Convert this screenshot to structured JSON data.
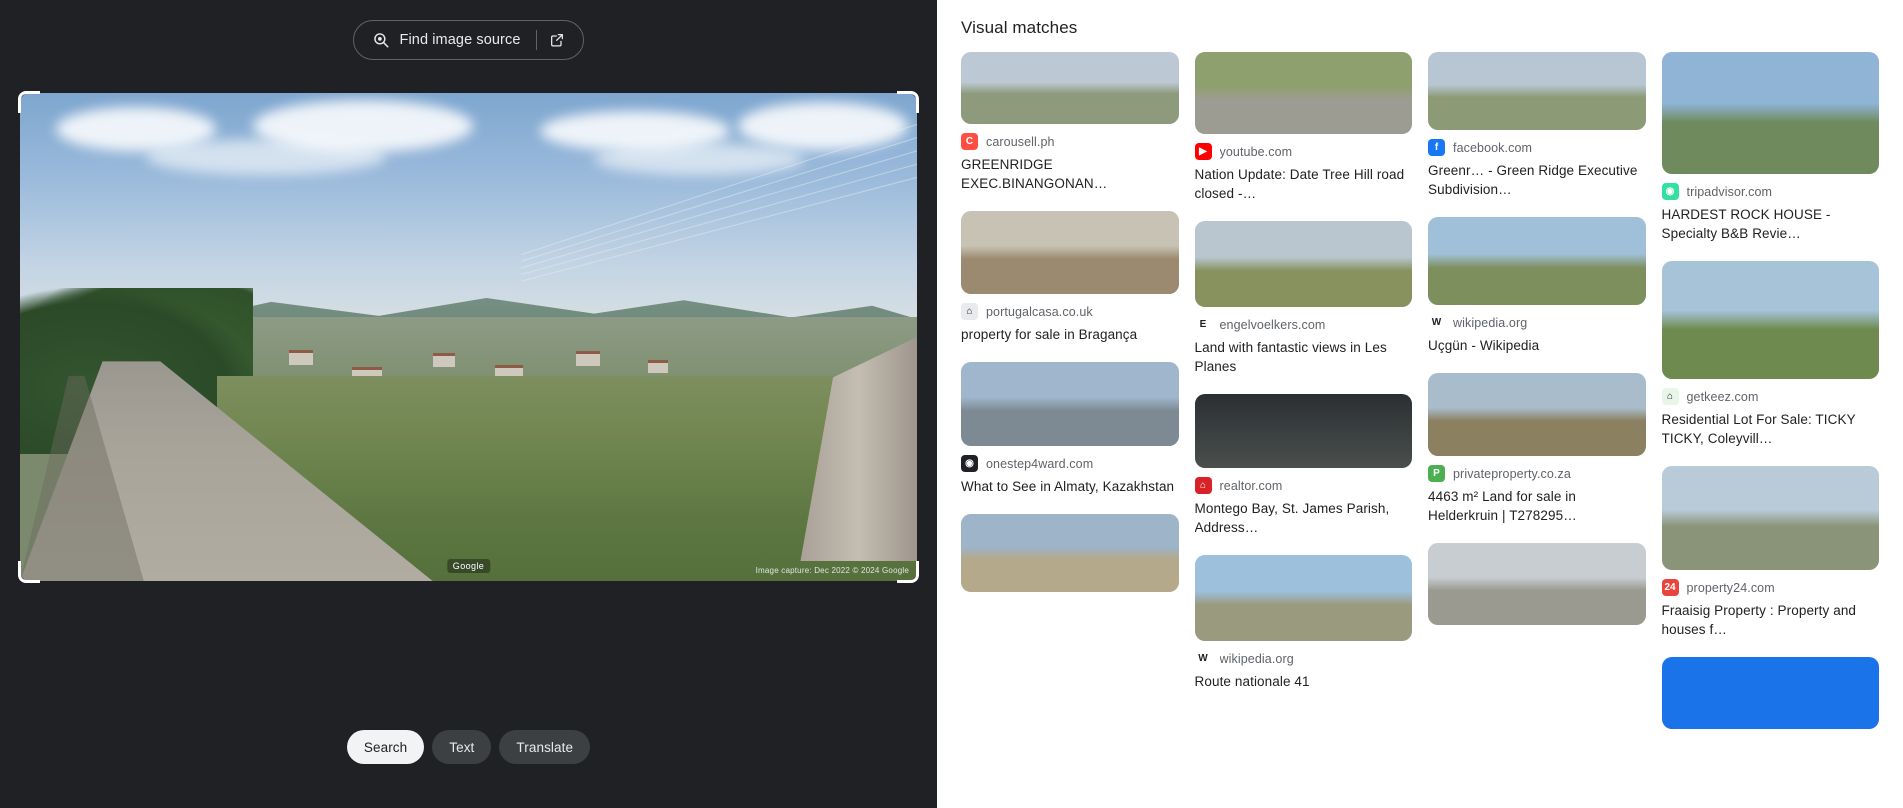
{
  "left": {
    "find_source_label": "Find image source",
    "find_source_icon": "lens-search-icon",
    "open_external_icon": "open-in-new-icon",
    "image_attribution": "Google",
    "image_attribution_right": "Image capture: Dec 2022  © 2024 Google",
    "tabs": [
      {
        "label": "Search",
        "active": true
      },
      {
        "label": "Text",
        "active": false
      },
      {
        "label": "Translate",
        "active": false
      }
    ]
  },
  "right": {
    "title": "Visual matches",
    "cards": [
      {
        "source": "carousell.ph",
        "title": "GREENRIDGE EXEC.BINANGONAN…",
        "thumb_h": 72,
        "favicon_bg": "#ff4f42",
        "favicon_glyph": "C",
        "col": 1,
        "sky": "#bcc9d4",
        "ground": "#8e9a7c",
        "kind": "road"
      },
      {
        "source": "portugalcasa.co.uk",
        "title": "property for sale in Bragança",
        "thumb_h": 83,
        "favicon_bg": "#e8eaed",
        "favicon_glyph": "⌂",
        "col": 1,
        "sky": "#c7c2b3",
        "ground": "#9b8a6f",
        "kind": "dirt"
      },
      {
        "source": "onestep4ward.com",
        "title": "What to See in Almaty, Kazakhstan",
        "thumb_h": 84,
        "favicon_bg": "#202124",
        "favicon_glyph": "◉",
        "col": 1,
        "sky": "#9fb6cc",
        "ground": "#7d8a93",
        "kind": "city"
      },
      {
        "source": "",
        "title": "",
        "thumb_h": 78,
        "favicon_bg": "",
        "favicon_glyph": "",
        "col": 1,
        "sky": "#9db4c9",
        "ground": "#b5a98c",
        "kind": "field"
      },
      {
        "source": "youtube.com",
        "title": "Nation Update: Date Tree Hill road closed -…",
        "thumb_h": 82,
        "favicon_bg": "#ff0000",
        "favicon_glyph": "▶",
        "col": 2,
        "sky": "#8fa06f",
        "ground": "#9d9c92",
        "kind": "road"
      },
      {
        "source": "engelvoelkers.com",
        "title": "Land with fantastic views in Les Planes",
        "thumb_h": 86,
        "favicon_bg": "#ffffff",
        "favicon_glyph": "E",
        "col": 2,
        "sky": "#b9c6cf",
        "ground": "#87925f",
        "kind": "field"
      },
      {
        "source": "realtor.com",
        "title": "Montego Bay, St. James Parish, Address…",
        "thumb_h": 74,
        "favicon_bg": "#d92228",
        "favicon_glyph": "⌂",
        "col": 2,
        "sky": "#2b2f33",
        "ground": "#4a4f4c",
        "kind": "night"
      },
      {
        "source": "wikipedia.org",
        "title": "Route nationale 41",
        "thumb_h": 86,
        "favicon_bg": "#ffffff",
        "favicon_glyph": "W",
        "col": 2,
        "sky": "#9dc0dc",
        "ground": "#9a9a7e",
        "kind": "road"
      },
      {
        "source": "facebook.com",
        "title": "Greenr… - Green Ridge Executive Subdivision…",
        "thumb_h": 78,
        "favicon_bg": "#1877f2",
        "favicon_glyph": "f",
        "col": 3,
        "sky": "#b7c6d2",
        "ground": "#8d9a76",
        "kind": "road"
      },
      {
        "source": "wikipedia.org",
        "title": "Uçgün - Wikipedia",
        "thumb_h": 88,
        "favicon_bg": "#ffffff",
        "favicon_glyph": "W",
        "col": 3,
        "sky": "#9fc0d8",
        "ground": "#7e8f5e",
        "kind": "field"
      },
      {
        "source": "privateproperty.co.za",
        "title": "4463 m² Land for sale in Helderkruin | T278295…",
        "thumb_h": 83,
        "favicon_bg": "#4caf50",
        "favicon_glyph": "P",
        "col": 3,
        "sky": "#a9bccb",
        "ground": "#8b8060",
        "kind": "city"
      },
      {
        "source": "",
        "title": "",
        "thumb_h": 82,
        "favicon_bg": "",
        "favicon_glyph": "",
        "col": 3,
        "sky": "#c8cdd2",
        "ground": "#9a9a90",
        "kind": "wall"
      },
      {
        "source": "tripadvisor.com",
        "title": "HARDEST ROCK HOUSE - Specialty B&B Revie…",
        "thumb_h": 122,
        "favicon_bg": "#34e0a1",
        "favicon_glyph": "◉",
        "col": 4,
        "sky": "#8fb4d6",
        "ground": "#6f8a5c",
        "kind": "hills"
      },
      {
        "source": "getkeez.com",
        "title": "Residential Lot For Sale: TICKY TICKY, Coleyvill…",
        "thumb_h": 118,
        "favicon_bg": "#e8f5e9",
        "favicon_glyph": "⌂",
        "col": 4,
        "sky": "#a6c3d8",
        "ground": "#6e8a4f",
        "kind": "field"
      },
      {
        "source": "property24.com",
        "title": "Fraaisig Property : Property and houses f…",
        "thumb_h": 104,
        "favicon_bg": "#e8453c",
        "favicon_glyph": "24",
        "col": 4,
        "sky": "#b9cbd9",
        "ground": "#8a9478",
        "kind": "city"
      },
      {
        "source": "",
        "title": "",
        "thumb_h": 72,
        "favicon_bg": "",
        "favicon_glyph": "",
        "col": 4,
        "sky": "#1a73e8",
        "ground": "#1a73e8",
        "kind": "blue"
      }
    ]
  }
}
